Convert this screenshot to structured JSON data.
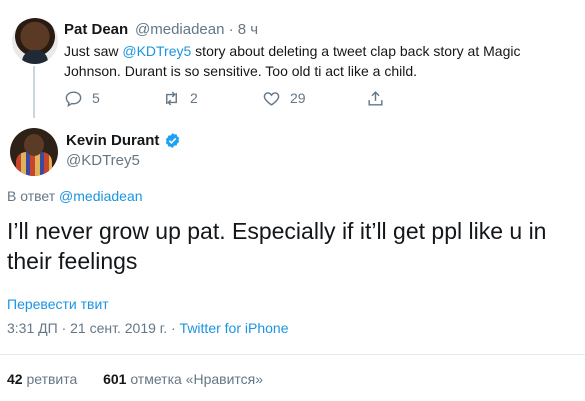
{
  "reply_tweet": {
    "author_name": "Pat Dean",
    "author_handle": "@mediadean",
    "separator": "·",
    "time_ago": "8 ч",
    "text_before": "Just saw ",
    "mention": "@KDTrey5",
    "text_after": " story about deleting a tweet clap back story at Magic Johnson. Durant is so sensitive. Too old ti act like a child.",
    "reply_count": "5",
    "retweet_count": "2",
    "like_count": "29",
    "icons": [
      "reply-icon",
      "retweet-icon",
      "like-icon",
      "share-icon"
    ]
  },
  "main_tweet": {
    "author_name": "Kevin Durant",
    "author_handle": "@KDTrey5",
    "reply_prefix": "В ответ ",
    "reply_to": "@mediadean",
    "text": "I’ll never grow up pat. Especially if it’ll get ppl like u in their feelings",
    "translate_label": "Перевести твит",
    "time": "3:31 ДП",
    "date_sep": " · ",
    "date": "21 сент. 2019 г.",
    "client_sep": " · ",
    "client": "Twitter for iPhone",
    "retweets_count": "42",
    "retweets_label": " ретвита",
    "likes_count": "601",
    "likes_label": " отметка «Нравится»"
  },
  "colors": {
    "link": "#1b95e0",
    "secondary": "#657786",
    "text": "#14171a",
    "verified": "#1da1f2",
    "divider": "#e6ecf0"
  }
}
